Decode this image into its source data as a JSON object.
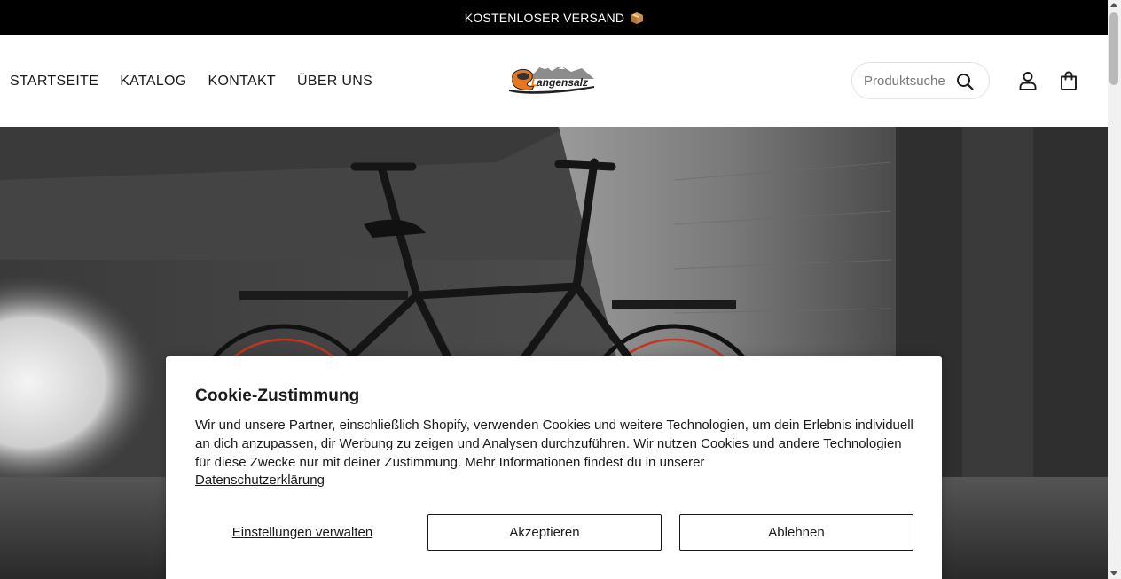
{
  "announcement": {
    "text": "KOSTENLOSER VERSAND",
    "icon": "package-icon"
  },
  "header": {
    "nav": [
      {
        "label": "STARTSEITE"
      },
      {
        "label": "KATALOG"
      },
      {
        "label": "KONTAKT"
      },
      {
        "label": "ÜBER UNS"
      }
    ],
    "logo_text": "Langensalz",
    "search": {
      "placeholder": "Produktsuche",
      "icon": "search-icon"
    },
    "account_icon": "user-icon",
    "cart_icon": "shopping-bag-icon"
  },
  "hero": {
    "image": "e-bikes-in-concrete-garage"
  },
  "cookie_banner": {
    "title": "Cookie-Zustimmung",
    "body": "Wir und unsere Partner, einschließlich Shopify, verwenden Cookies und weitere Technologien, um dein Erlebnis individuell an dich anzupassen, dir Werbung zu zeigen und Analysen durchzuführen. Wir nutzen Cookies und andere Technologien für diese Zwecke nur mit deiner Zustimmung. Mehr Informationen findest du in unserer",
    "privacy_link": "Datenschutzerklärung",
    "manage_label": "Einstellungen verwalten",
    "accept_label": "Akzeptieren",
    "decline_label": "Ablehnen"
  },
  "colors": {
    "announcement_bg": "#000000",
    "text": "#1a1a1a",
    "logo_orange": "#e8761c"
  }
}
